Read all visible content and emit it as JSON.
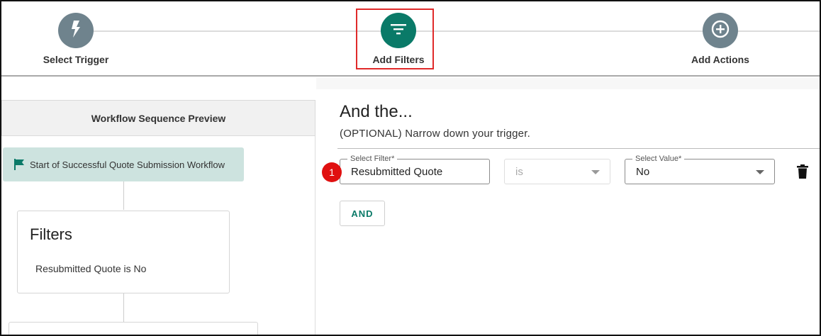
{
  "stepper": {
    "steps": [
      {
        "label": "Select Trigger",
        "icon": "lightning-bolt-icon"
      },
      {
        "label": "Add Filters",
        "icon": "filter-icon"
      },
      {
        "label": "Add Actions",
        "icon": "plus-circle-icon"
      }
    ],
    "active_color": "#0a7a68",
    "inactive_color": "#6f838d",
    "highlight_color": "#e02a2a"
  },
  "preview": {
    "header": "Workflow Sequence Preview",
    "start_node": {
      "label": "Start of Successful Quote Submission Workflow",
      "icon": "flag-icon"
    },
    "filters_card": {
      "title": "Filters",
      "description": "Resubmitted Quote is No"
    }
  },
  "filter_panel": {
    "title": "And the...",
    "subtitle": "(OPTIONAL) Narrow down your trigger.",
    "row": {
      "badge": "1",
      "filter_label": "Select Filter*",
      "filter_value": "Resubmitted Quote",
      "operator_value": "is",
      "value_label": "Select Value*",
      "value_value": "No",
      "delete_icon": "trash-icon"
    },
    "and_button": "AND"
  }
}
